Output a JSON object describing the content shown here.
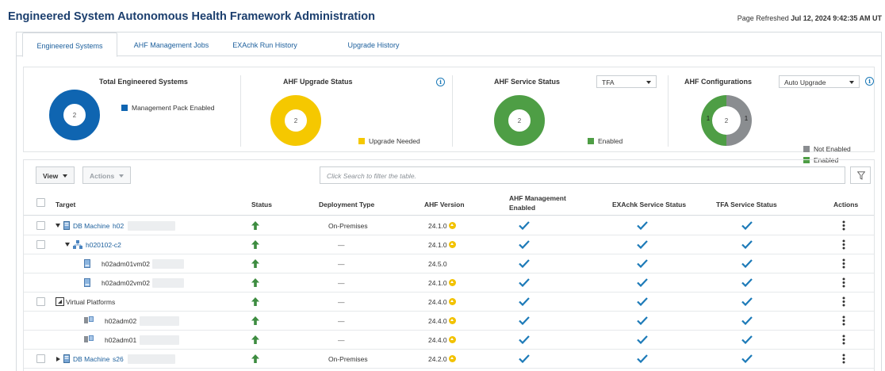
{
  "page": {
    "title": "Engineered System Autonomous Health Framework Administration",
    "refresh_label": "Page Refreshed",
    "refresh_time": "Jul 12, 2024 9:42:35 AM UT"
  },
  "tabs": [
    {
      "label": "Engineered Systems",
      "active": true
    },
    {
      "label": "AHF Management Jobs",
      "active": false
    },
    {
      "label": "EXAchk Run History",
      "active": false
    },
    {
      "label": "Upgrade History",
      "active": false
    }
  ],
  "summary": {
    "total_systems": {
      "title": "Total Engineered Systems",
      "center": "2",
      "legend": "Management Pack Enabled",
      "color": "#0f65b1"
    },
    "upgrade_status": {
      "title": "AHF Upgrade Status",
      "center": "2",
      "legend": "Upgrade Needed",
      "color": "#f5c800"
    },
    "service_status": {
      "title": "AHF Service Status",
      "center": "2",
      "legend": "Enabled",
      "color": "#4e9e45",
      "select": "TFA"
    },
    "configurations": {
      "title": "AHF Configurations",
      "center": "2",
      "select": "Auto Upgrade",
      "enabled_count": "1",
      "not_enabled_count": "1",
      "legend_not_enabled": "Not Enabled",
      "legend_enabled": "Enabled",
      "color_not_enabled": "#8a8d90",
      "color_enabled": "#4e9e45"
    }
  },
  "chart_data": [
    {
      "type": "pie",
      "title": "Total Engineered Systems",
      "labels": [
        "Management Pack Enabled"
      ],
      "values": [
        2
      ]
    },
    {
      "type": "pie",
      "title": "AHF Upgrade Status",
      "labels": [
        "Upgrade Needed"
      ],
      "values": [
        2
      ]
    },
    {
      "type": "pie",
      "title": "AHF Service Status",
      "labels": [
        "Enabled"
      ],
      "values": [
        2
      ]
    },
    {
      "type": "pie",
      "title": "AHF Configurations",
      "labels": [
        "Not Enabled",
        "Enabled"
      ],
      "values": [
        1,
        1
      ]
    }
  ],
  "toolbar": {
    "view_label": "View",
    "actions_label": "Actions",
    "search_placeholder": "Click Search to filter the table."
  },
  "table": {
    "headers": {
      "target": "Target",
      "status": "Status",
      "deployment": "Deployment Type",
      "version": "AHF Version",
      "mgmt_line1": "AHF Management",
      "mgmt_line2": "Enabled",
      "exachk": "EXAchk Service Status",
      "tfa": "TFA Service Status",
      "actions": "Actions"
    },
    "rows": [
      {
        "prefix": "DB Machine",
        "name": "h02",
        "deployment": "On-Premises",
        "version": "24.1.0"
      },
      {
        "prefix": "",
        "name": "h020102-c2",
        "deployment": "—",
        "version": "24.1.0"
      },
      {
        "prefix": "",
        "name": "h02adm01vm02",
        "deployment": "—",
        "version": "24.5.0"
      },
      {
        "prefix": "",
        "name": "h02adm02vm02",
        "deployment": "—",
        "version": "24.1.0"
      },
      {
        "prefix": "",
        "name": "Virtual Platforms",
        "deployment": "—",
        "version": "24.4.0"
      },
      {
        "prefix": "",
        "name": "h02adm02",
        "deployment": "—",
        "version": "24.4.0"
      },
      {
        "prefix": "",
        "name": "h02adm01",
        "deployment": "—",
        "version": "24.4.0"
      },
      {
        "prefix": "DB Machine",
        "name": "s26",
        "deployment": "On-Premises",
        "version": "24.2.0"
      }
    ]
  },
  "colors": {
    "link": "#1c5f9c",
    "status_up": "#3d8c40",
    "check": "#1c7ab8",
    "upgrade_badge": "#f2c200"
  }
}
